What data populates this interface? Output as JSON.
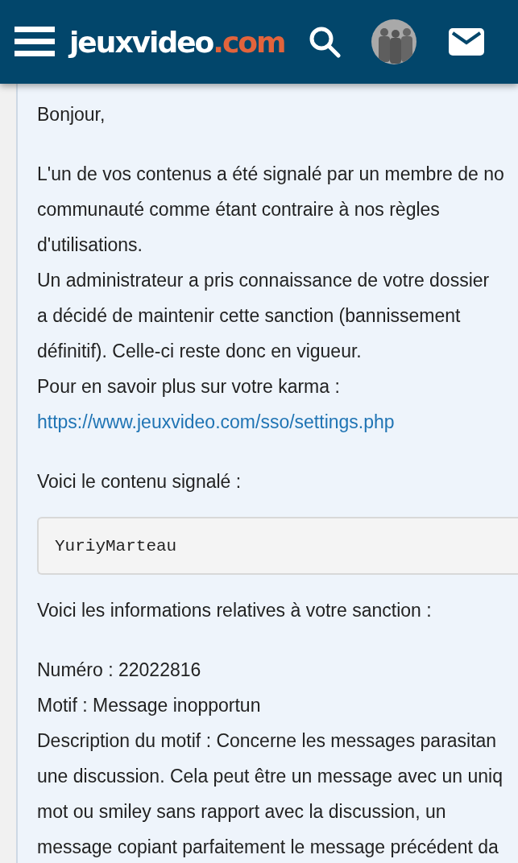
{
  "header": {
    "logo": {
      "name": "jeuxvideo",
      "suffix": ".com"
    }
  },
  "message": [
    {
      "lines": [
        {
          "kind": "text",
          "text": "Bonjour,"
        }
      ]
    },
    {
      "lines": [
        {
          "kind": "text",
          "text": "L'un de vos contenus a été signalé par un membre de no"
        },
        {
          "kind": "text",
          "text": "communauté comme étant contraire à nos règles"
        },
        {
          "kind": "text",
          "text": "d'utilisations."
        },
        {
          "kind": "text",
          "text": "Un administrateur a pris connaissance de votre dossier"
        },
        {
          "kind": "text",
          "text": "a décidé de maintenir cette sanction (bannissement"
        },
        {
          "kind": "text",
          "text": "définitif). Celle-ci reste donc en vigueur."
        },
        {
          "kind": "text",
          "text": "Pour en savoir plus sur votre karma :"
        },
        {
          "kind": "link",
          "text": "https://www.jeuxvideo.com/sso/settings.php"
        }
      ]
    },
    {
      "lines": [
        {
          "kind": "text",
          "text": "Voici le contenu signalé :"
        }
      ]
    },
    {
      "lines": [
        {
          "kind": "quote",
          "text": "YuriyMarteau"
        },
        {
          "kind": "text",
          "text": "Voici les informations relatives à votre sanction :"
        }
      ]
    },
    {
      "lines": [
        {
          "kind": "text",
          "text": "Numéro : 22022816"
        },
        {
          "kind": "text",
          "text": "Motif : Message inopportun"
        },
        {
          "kind": "text",
          "text": "Description du motif : Concerne les messages parasitan"
        },
        {
          "kind": "text",
          "text": "une discussion. Cela peut être un message avec un uniq"
        },
        {
          "kind": "text",
          "text": "mot ou smiley sans rapport avec la discussion, un"
        },
        {
          "kind": "text",
          "text": "message copiant parfaitement le message précédent da"
        }
      ]
    }
  ]
}
